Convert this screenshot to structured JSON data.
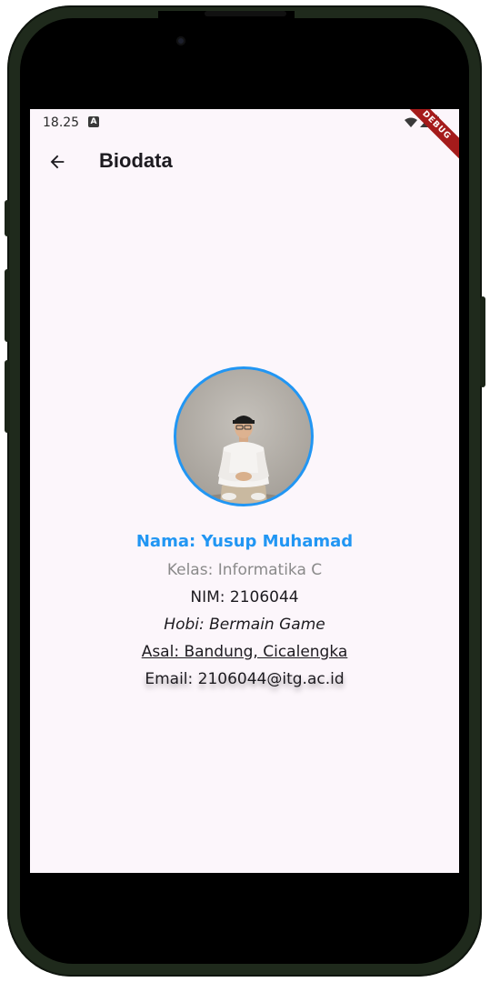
{
  "status_bar": {
    "time": "18.25",
    "notification_icon": "A",
    "icons": [
      "wifi-icon",
      "signal-icon",
      "battery-icon"
    ],
    "debug_label": "DEBUG"
  },
  "app_bar": {
    "back_icon": "arrow-left-icon",
    "title": "Biodata"
  },
  "profile": {
    "avatar_icon": "profile-photo",
    "nama": "Nama: Yusup Muhamad",
    "kelas": "Kelas: Informatika C",
    "nim": "NIM: 2106044",
    "hobi": "Hobi: Bermain Game",
    "asal": "Asal: Bandung, Cicalengka",
    "email": "Email: 2106044@itg.ac.id"
  },
  "colors": {
    "accent": "#2196f3",
    "background": "#fcf6fb",
    "frame": "#1f2a1c",
    "debug_banner": "#a51b1b"
  }
}
